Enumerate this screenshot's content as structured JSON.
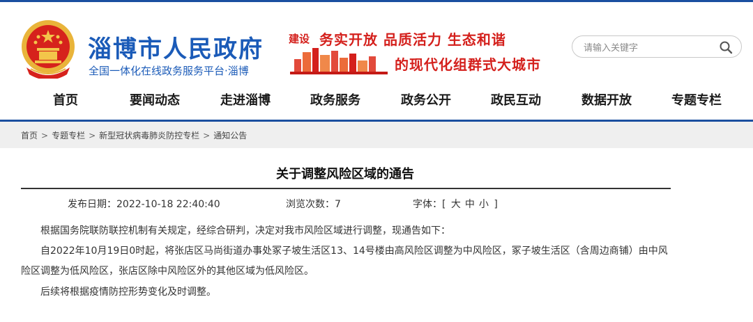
{
  "header": {
    "site_title": "淄博市人民政府",
    "site_subtitle": "全国一体化在线政务服务平台·淄博",
    "slogan_lead": "建设",
    "slogan_line1": "务实开放  品质活力  生态和谐",
    "slogan_line2": "的现代化组群式大城市",
    "search_placeholder": "请输入关键字"
  },
  "nav": {
    "items": [
      "首页",
      "要闻动态",
      "走进淄博",
      "政务服务",
      "政务公开",
      "政民互动",
      "数据开放",
      "专题专栏"
    ]
  },
  "breadcrumb": {
    "items": [
      "首页",
      "专题专栏",
      "新型冠状病毒肺炎防控专栏",
      "通知公告"
    ],
    "separator": ">"
  },
  "article": {
    "title": "关于调整风险区域的通告",
    "publish_label": "发布日期：",
    "publish_date": "2022-10-18 22:40:40",
    "views_label": "浏览次数：",
    "views": "7",
    "font_label": "字体：",
    "font_open": "[",
    "font_large": "大",
    "font_medium": "中",
    "font_small": "小",
    "font_close": "]",
    "paragraphs": [
      "根据国务院联防联控机制有关规定，经综合研判，决定对我市风险区域进行调整，现通告如下：",
      "自2022年10月19日0时起，将张店区马尚街道办事处冢子坡生活区13、14号楼由高风险区调整为中风险区，冢子坡生活区（含周边商铺）由中风险区调整为低风险区，张店区除中风险区外的其他区域为低风险区。",
      "后续将根据疫情防控形势变化及时调整。"
    ]
  },
  "colors": {
    "brand_blue": "#1b5bb8",
    "accent_red": "#d4201c",
    "bar_blue": "#1a4fa0"
  },
  "icons": {
    "emblem": "national-emblem-icon",
    "search": "search-icon"
  }
}
